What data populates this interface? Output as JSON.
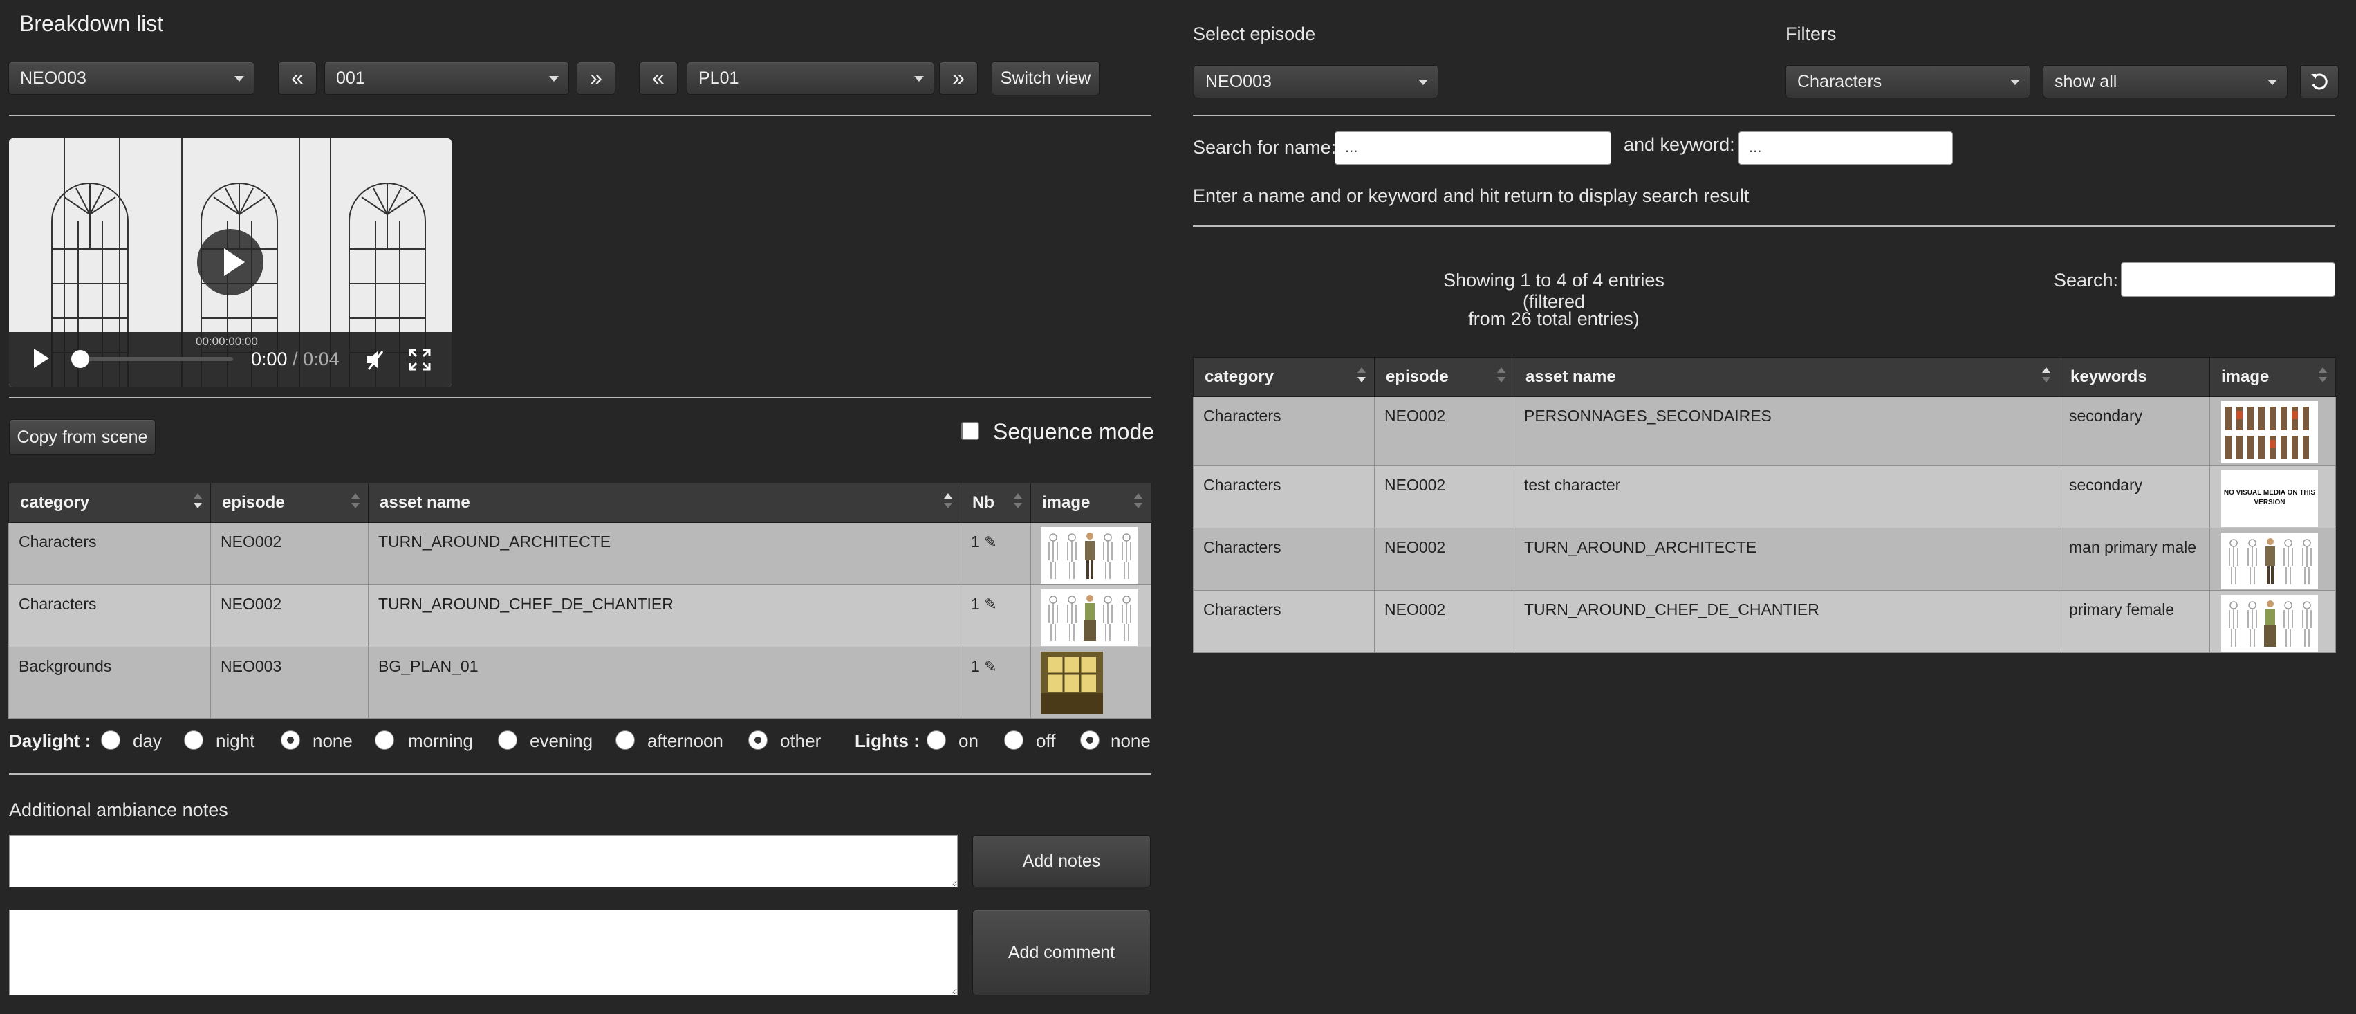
{
  "page_title": "Breakdown list",
  "nav": {
    "episode_select": "NEO003",
    "sequence_select": "001",
    "shot_select": "PL01",
    "prev_symbol": "«",
    "next_symbol": "»",
    "switch_view_label": "Switch view"
  },
  "video": {
    "current_time": "0:00",
    "separator": "/",
    "duration": "0:04",
    "timecode": "00:00:00:00",
    "progress": 0
  },
  "copy_from_scene_label": "Copy from scene",
  "sequence_mode_label": "Sequence mode",
  "sequence_mode_checked": false,
  "breakdown_table": {
    "columns": [
      "category",
      "episode",
      "asset name",
      "Nb",
      "image"
    ],
    "rows": [
      {
        "category": "Characters",
        "episode": "NEO002",
        "asset_name": "TURN_AROUND_ARCHITECTE",
        "nb": "1",
        "image": "turnaround-architect"
      },
      {
        "category": "Characters",
        "episode": "NEO002",
        "asset_name": "TURN_AROUND_CHEF_DE_CHANTIER",
        "nb": "1",
        "image": "turnaround-chef"
      },
      {
        "category": "Backgrounds",
        "episode": "NEO003",
        "asset_name": "BG_PLAN_01",
        "nb": "1",
        "image": "bg-plan"
      }
    ]
  },
  "daylight": {
    "label": "Daylight :",
    "options": [
      "day",
      "night",
      "none",
      "morning",
      "evening",
      "afternoon",
      "other"
    ],
    "selected": [
      "none",
      "other"
    ]
  },
  "lights": {
    "label": "Lights :",
    "options": [
      "on",
      "off",
      "none"
    ],
    "selected": "none"
  },
  "ambiance_label": "Additional ambiance notes",
  "add_notes_label": "Add notes",
  "add_comment_label": "Add comment",
  "right": {
    "select_episode_label": "Select episode",
    "episode_select": "NEO003",
    "filters_label": "Filters",
    "filter_category": "Characters",
    "filter_show": "show all",
    "search_name_label": "Search for name:",
    "search_name_placeholder": "...",
    "keyword_label": "and keyword:",
    "keyword_placeholder": "...",
    "hint": "Enter a name and or keyword and hit return to display search result",
    "showing_line1": "Showing 1 to 4 of 4 entries (filtered",
    "showing_line2": "from 26 total entries)",
    "search_label": "Search:",
    "search_value": ""
  },
  "assets_table": {
    "columns": [
      "category",
      "episode",
      "asset name",
      "keywords",
      "image"
    ],
    "rows": [
      {
        "category": "Characters",
        "episode": "NEO002",
        "asset_name": "PERSONNAGES_SECONDAIRES",
        "keywords": "secondary",
        "image": "secondary-characters"
      },
      {
        "category": "Characters",
        "episode": "NEO002",
        "asset_name": "test character",
        "keywords": "secondary",
        "image_text": "NO VISUAL MEDIA ON THIS VERSION"
      },
      {
        "category": "Characters",
        "episode": "NEO002",
        "asset_name": "TURN_AROUND_ARCHITECTE",
        "keywords": "man primary male",
        "image": "turnaround-architect"
      },
      {
        "category": "Characters",
        "episode": "NEO002",
        "asset_name": "TURN_AROUND_CHEF_DE_CHANTIER",
        "keywords": "primary female",
        "image": "turnaround-chef"
      }
    ]
  }
}
